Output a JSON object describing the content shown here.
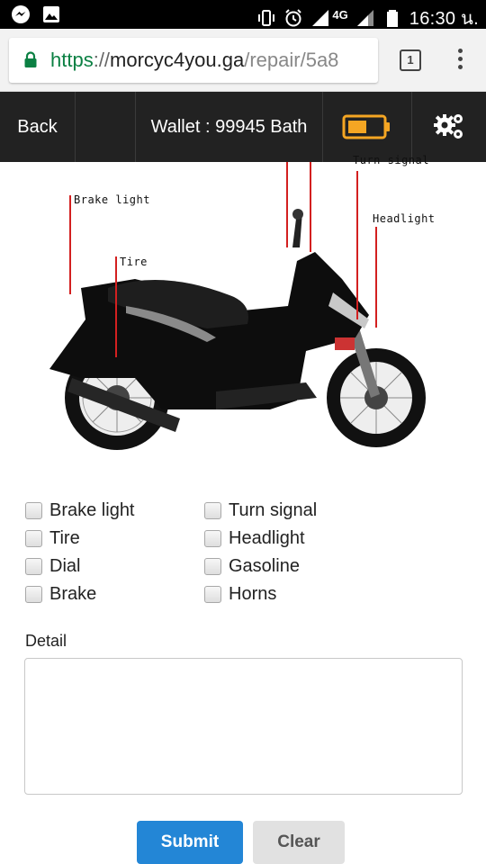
{
  "status_bar": {
    "time": "16:30 น.",
    "network": "4G",
    "icons": [
      "messenger-icon",
      "image-icon",
      "vibrate-icon",
      "alarm-icon",
      "signal-icon",
      "battery-icon"
    ]
  },
  "browser": {
    "url_scheme": "https",
    "url_separator": "://",
    "url_host": "morcyc4you.ga",
    "url_path": "/repair/5a8",
    "tab_count": "1"
  },
  "navbar": {
    "back_label": "Back",
    "wallet_text": "Wallet : 99945 Bath",
    "accent_color": "#f5a623"
  },
  "diagram": {
    "callouts": {
      "brake_light": "Brake light",
      "tire": "Tire",
      "turn_signal": "Turn signal",
      "headlight": "Headlight"
    }
  },
  "form": {
    "options": [
      {
        "label": "Brake light",
        "checked": false
      },
      {
        "label": "Tire",
        "checked": false
      },
      {
        "label": "Dial",
        "checked": false
      },
      {
        "label": "Brake",
        "checked": false
      },
      {
        "label": "Turn signal",
        "checked": false
      },
      {
        "label": "Headlight",
        "checked": false
      },
      {
        "label": "Gasoline",
        "checked": false
      },
      {
        "label": "Horns",
        "checked": false
      }
    ],
    "detail_label": "Detail",
    "detail_value": "",
    "submit_label": "Submit",
    "clear_label": "Clear",
    "submit_color": "#2386d6"
  }
}
